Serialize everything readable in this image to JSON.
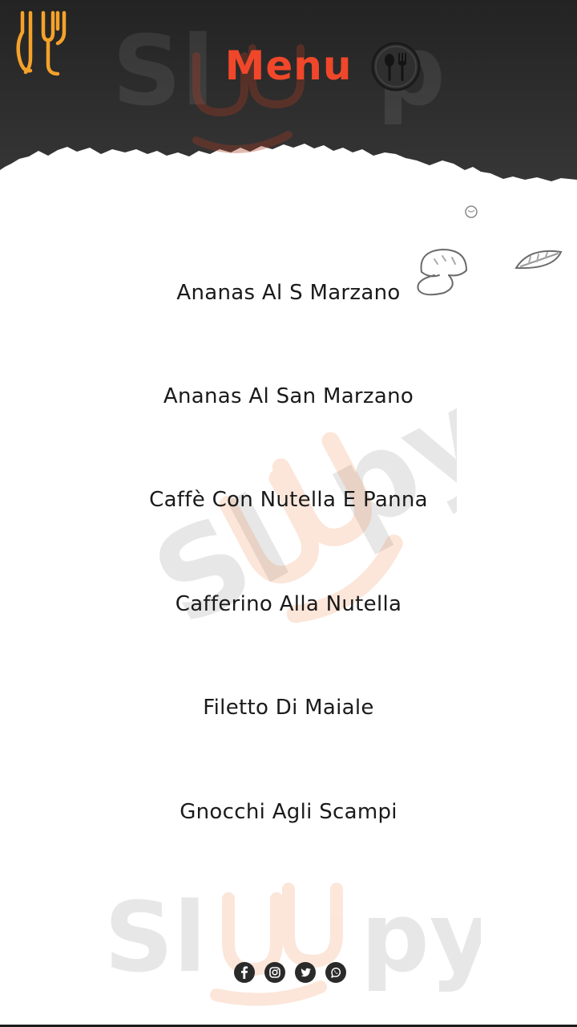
{
  "header": {
    "title": "Menu",
    "logo_icon": "fork-knife-logo-icon",
    "menu_icon": "spoon-fork-circle-icon"
  },
  "menu": {
    "items": [
      {
        "label": "Ananas Al S Marzano"
      },
      {
        "label": "Ananas Al San Marzano"
      },
      {
        "label": "Caffè Con Nutella E Panna"
      },
      {
        "label": "Cafferino Alla Nutella"
      },
      {
        "label": "Filetto Di Maiale"
      },
      {
        "label": "Gnocchi Agli Scampi"
      }
    ]
  },
  "social": {
    "icons": [
      "facebook-icon",
      "instagram-icon",
      "twitter-icon",
      "whatsapp-icon"
    ]
  },
  "colors": {
    "accent": "#f0472a",
    "header_bg": "#2b2b2b",
    "logo_orange": "#f5a22a",
    "text": "#1a1a1a"
  }
}
